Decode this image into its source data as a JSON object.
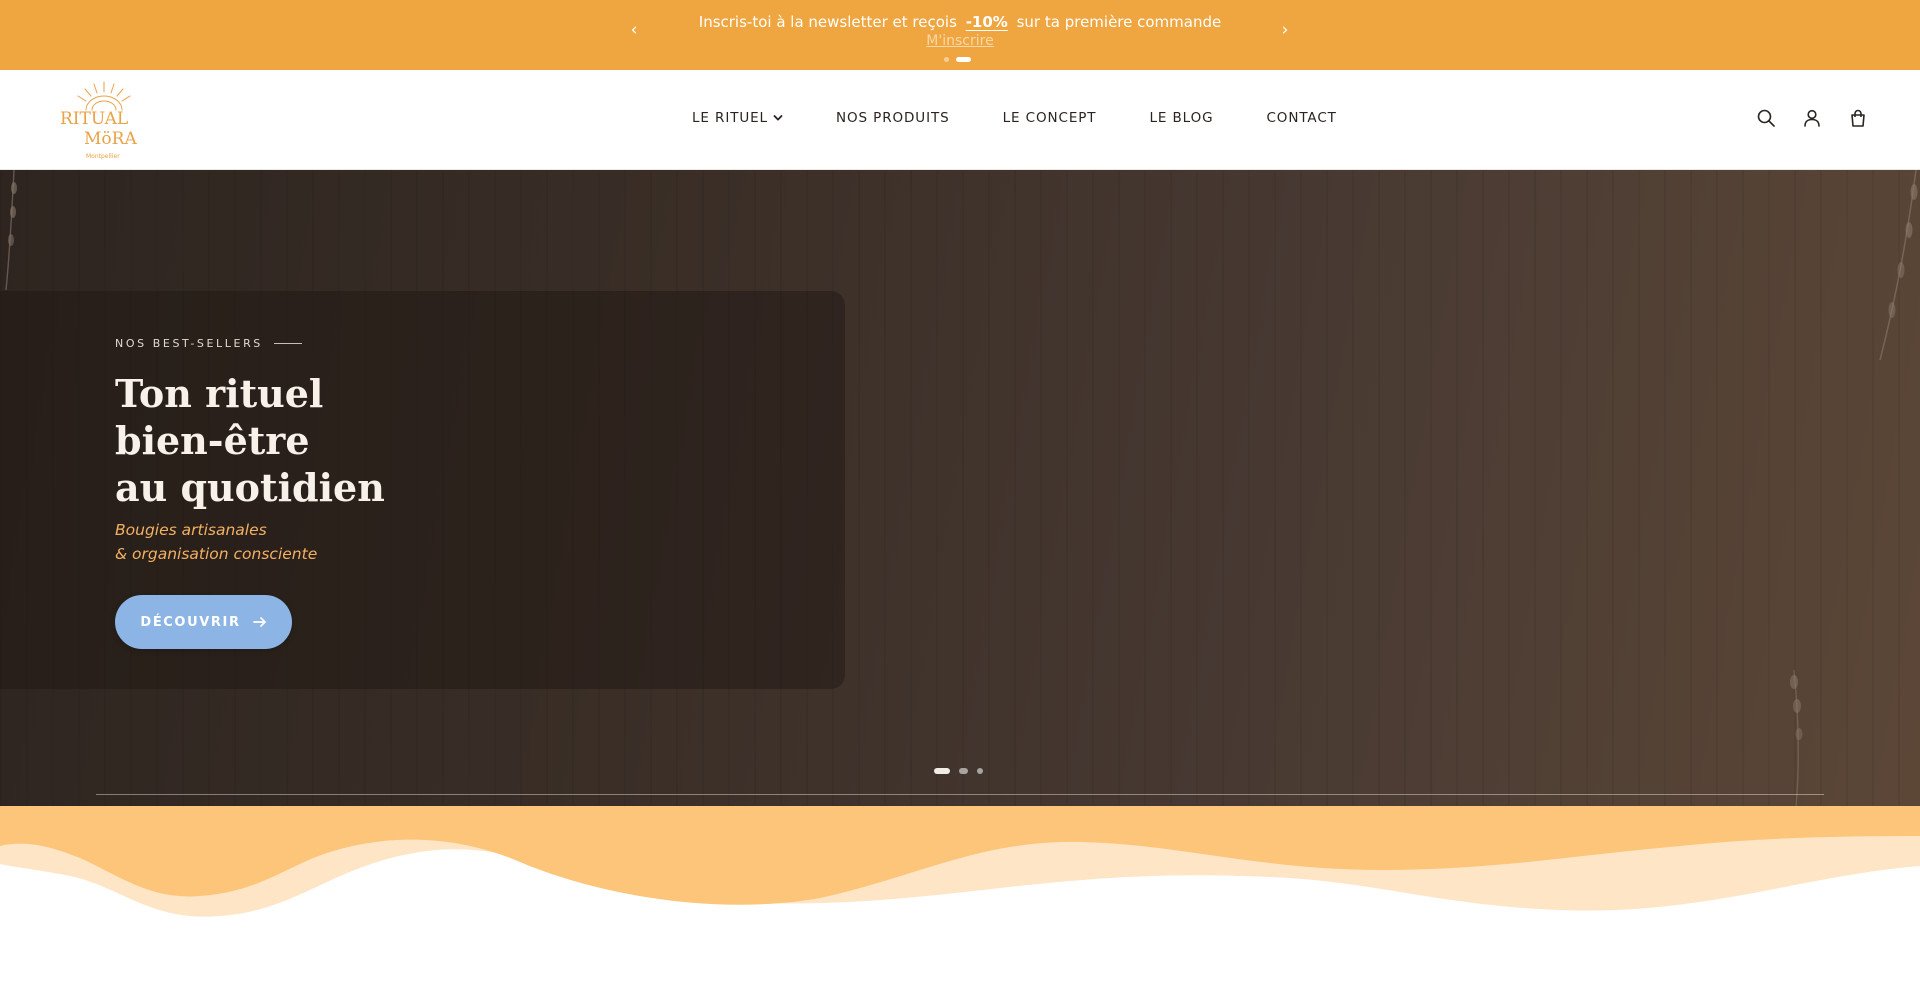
{
  "announcement": {
    "text_before": "Inscris-toi à la newsletter et reçois",
    "promo": "-10%",
    "text_after": "sur ta première commande",
    "ghost_text": "M'inscrire",
    "prev_icon": "chevron-left-icon",
    "next_icon": "chevron-right-icon",
    "slide_count": 2,
    "active_slide": 2,
    "bg_color": "#f0a640"
  },
  "header": {
    "logo_alt": "Ritual Mora",
    "nav": [
      {
        "label": "LE RITUEL",
        "has_dropdown": true
      },
      {
        "label": "NOS PRODUITS"
      },
      {
        "label": "LE CONCEPT"
      },
      {
        "label": "LE BLOG"
      },
      {
        "label": "CONTACT"
      }
    ],
    "icons": [
      "search-icon",
      "account-icon",
      "cart-icon"
    ]
  },
  "hero": {
    "eyebrow": "NOS BEST-SELLERS",
    "title_lines": [
      "Ton rituel",
      "bien-être",
      "au quotidien"
    ],
    "subtitle_lines": [
      "Bougies artisanales",
      "& organisation consciente"
    ],
    "cta_label": "DÉCOUVRIR",
    "cta_icon": "arrow-right-icon",
    "slide_count": 3,
    "active_slide": 1,
    "accent_color": "#f3b063",
    "cta_color": "#8cb5e6"
  },
  "waves": {
    "colors": [
      "#fcc57a",
      "#fde5c5"
    ]
  }
}
